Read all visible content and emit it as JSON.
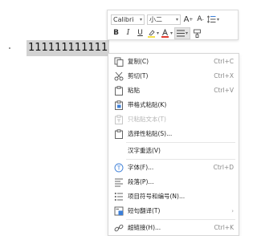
{
  "document": {
    "text": "111111111111"
  },
  "mini_toolbar": {
    "font_name": "Calibri",
    "font_size": "小二",
    "grow_font_label": "A",
    "shrink_font_label": "A",
    "bold_label": "B",
    "italic_label": "I",
    "underline_label": "U"
  },
  "context_menu": {
    "items": [
      {
        "label": "复制(C)",
        "shortcut": "Ctrl+C",
        "icon": "copy-icon",
        "disabled": false
      },
      {
        "label": "剪切(T)",
        "shortcut": "Ctrl+X",
        "icon": "scissors-icon",
        "disabled": false
      },
      {
        "label": "粘贴",
        "shortcut": "Ctrl+V",
        "icon": "paste-icon",
        "disabled": false
      },
      {
        "label": "带格式粘贴(K)",
        "shortcut": "",
        "icon": "paste-format-icon",
        "disabled": false
      },
      {
        "label": "只粘贴文本(T)",
        "shortcut": "",
        "icon": "paste-text-icon",
        "disabled": true
      },
      {
        "label": "选择性粘贴(S)...",
        "shortcut": "",
        "icon": "paste-special-icon",
        "disabled": false
      },
      {
        "label": "汉字重选(V)",
        "shortcut": "",
        "icon": "",
        "disabled": false
      },
      {
        "label": "字体(F)...",
        "shortcut": "Ctrl+D",
        "icon": "font-icon",
        "disabled": false
      },
      {
        "label": "段落(P)...",
        "shortcut": "",
        "icon": "paragraph-icon",
        "disabled": false
      },
      {
        "label": "项目符号和编号(N)...",
        "shortcut": "",
        "icon": "bullets-icon",
        "disabled": false
      },
      {
        "label": "短句翻译(T)",
        "shortcut": "",
        "icon": "translate-icon",
        "disabled": false,
        "submenu": true
      },
      {
        "label": "超链接(H)...",
        "shortcut": "Ctrl+K",
        "icon": "link-icon",
        "disabled": false
      }
    ]
  },
  "colors": {
    "selection": "#d2d2d2",
    "highlight_yellow": "#f5e04a",
    "font_red": "#e23b2e",
    "accent_blue": "#3c7fd8"
  }
}
